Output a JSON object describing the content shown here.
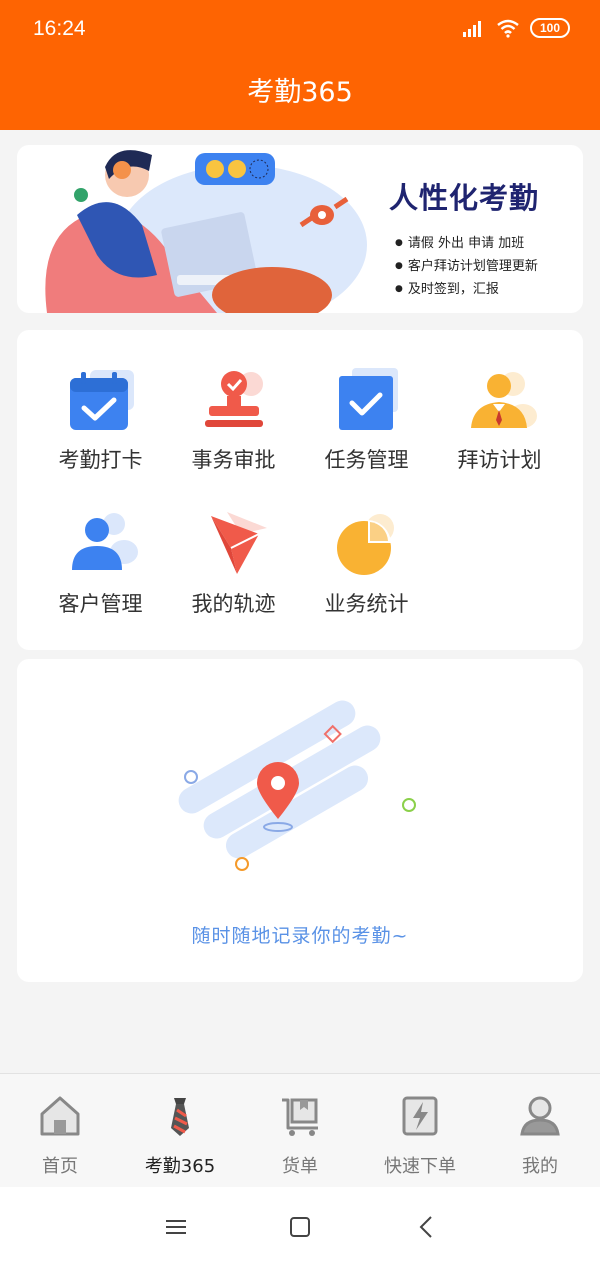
{
  "status": {
    "time": "16:24",
    "battery": "100"
  },
  "header": {
    "title": "考勤365"
  },
  "banner": {
    "title": "人性化考勤",
    "items": [
      "请假 外出 申请 加班",
      "客户拜访计划管理更新",
      "及时签到，汇报"
    ]
  },
  "functions": [
    {
      "label": "考勤打卡",
      "icon": "calendar-check-icon"
    },
    {
      "label": "事务审批",
      "icon": "stamp-icon"
    },
    {
      "label": "任务管理",
      "icon": "task-check-icon"
    },
    {
      "label": "拜访计划",
      "icon": "visitor-icon"
    },
    {
      "label": "客户管理",
      "icon": "customer-icon"
    },
    {
      "label": "我的轨迹",
      "icon": "paper-plane-icon"
    },
    {
      "label": "业务统计",
      "icon": "pie-chart-icon"
    }
  ],
  "empty_state": {
    "text": "随时随地记录你的考勤~"
  },
  "tabbar": {
    "items": [
      {
        "label": "首页",
        "icon": "home-icon",
        "active": false
      },
      {
        "label": "考勤365",
        "icon": "tie-icon",
        "active": true
      },
      {
        "label": "货单",
        "icon": "cart-icon",
        "active": false
      },
      {
        "label": "快速下单",
        "icon": "lightning-icon",
        "active": false
      },
      {
        "label": "我的",
        "icon": "user-icon",
        "active": false
      }
    ]
  },
  "colors": {
    "accent": "#fe6402",
    "blue": "#3d82f0",
    "red": "#f05a4a",
    "yellow": "#f9b233"
  }
}
